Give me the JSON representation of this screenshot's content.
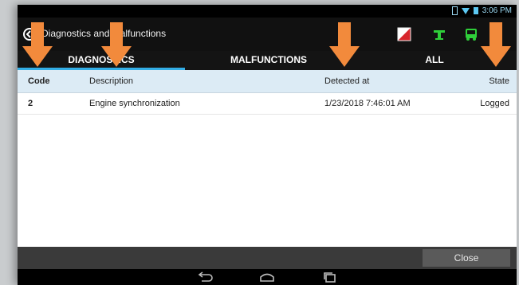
{
  "statusbar": {
    "time": "3:06 PM"
  },
  "actionbar": {
    "title": "Diagnostics and malfunctions"
  },
  "tabs": [
    {
      "label": "DIAGNOSTICS",
      "active": true
    },
    {
      "label": "MALFUNCTIONS",
      "active": false
    },
    {
      "label": "ALL",
      "active": false
    }
  ],
  "table": {
    "headers": [
      "Code",
      "Description",
      "Detected at",
      "State"
    ],
    "rows": [
      {
        "code": "2",
        "description": "Engine synchronization",
        "detected_at": "1/23/2018 7:46:01 AM",
        "state": "Logged"
      }
    ]
  },
  "footer": {
    "close_label": "Close"
  },
  "colors": {
    "accent": "#33aee6",
    "arrow": "#f28a3c",
    "header_bg": "#dcebf5",
    "icon_green": "#2fcf3a"
  },
  "icons": [
    "back-icon",
    "phone-icon",
    "plug-icon",
    "bus-icon",
    "back-nav-icon",
    "home-nav-icon",
    "recents-nav-icon"
  ]
}
